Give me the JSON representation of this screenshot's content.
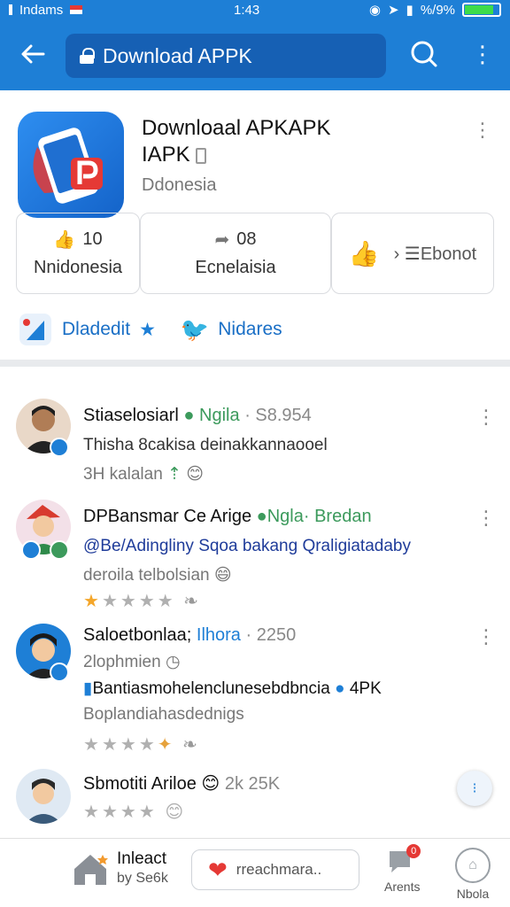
{
  "status_bar": {
    "carrier": "Indams",
    "time": "1:43",
    "battery_text": "%/9%",
    "battery_level": 0.85
  },
  "app_bar": {
    "title": "Download APPK",
    "icons": [
      "back-arrow-icon",
      "lock-icon",
      "search-icon",
      "more-vert-icon"
    ]
  },
  "app": {
    "title_line1": "Downloaal APKAPK",
    "title_line2": "IAPK",
    "subtitle": "Ddonesia",
    "stats": [
      {
        "value": "10",
        "label": "Nnidonesia"
      },
      {
        "value": "08",
        "label": "Ecnelaisia"
      },
      {
        "value": "Ebonot",
        "label": ""
      }
    ]
  },
  "links": {
    "first": "Dladedit",
    "second": "Nidares"
  },
  "reviews": [
    {
      "name": "Stiaselosiarl",
      "meta": "Ngila",
      "count": "· S8.954",
      "line1": "Thisha 8cakisa deinakkannaooel",
      "line2": "3H kalalan"
    },
    {
      "name": "DPBansmar Ce Arige",
      "meta": "Ngla· Bredan",
      "line1": "@Be/Adingliny Sqoa bakang Qraligiatadaby",
      "line2": "deroila telbolsian",
      "stars": 1
    },
    {
      "name": "Saloetbonlaa;",
      "meta": "Ilhora",
      "count": "· 2250",
      "line1": "2lophmien",
      "line2": "Bantiasmohelenclunesebdbncia",
      "line2_suffix": "4PK",
      "line3": "Boplandiahasdednigs",
      "stars": 0
    },
    {
      "name": "Sbmotiti Ariloe",
      "count": "2k 25K",
      "stars": 0
    }
  ],
  "bottom_nav": {
    "home_title": "Inleact",
    "home_sub": "by Se6k",
    "input_text": "rreachmara..",
    "tab1_label": "Arents",
    "tab2_label": "Nbola",
    "tab1_badge": "0"
  },
  "colors": {
    "primary": "#1e7fd6",
    "primary_dark": "#1660b4",
    "star": "#f4a62a",
    "verified_green": "#3c9a5c"
  }
}
